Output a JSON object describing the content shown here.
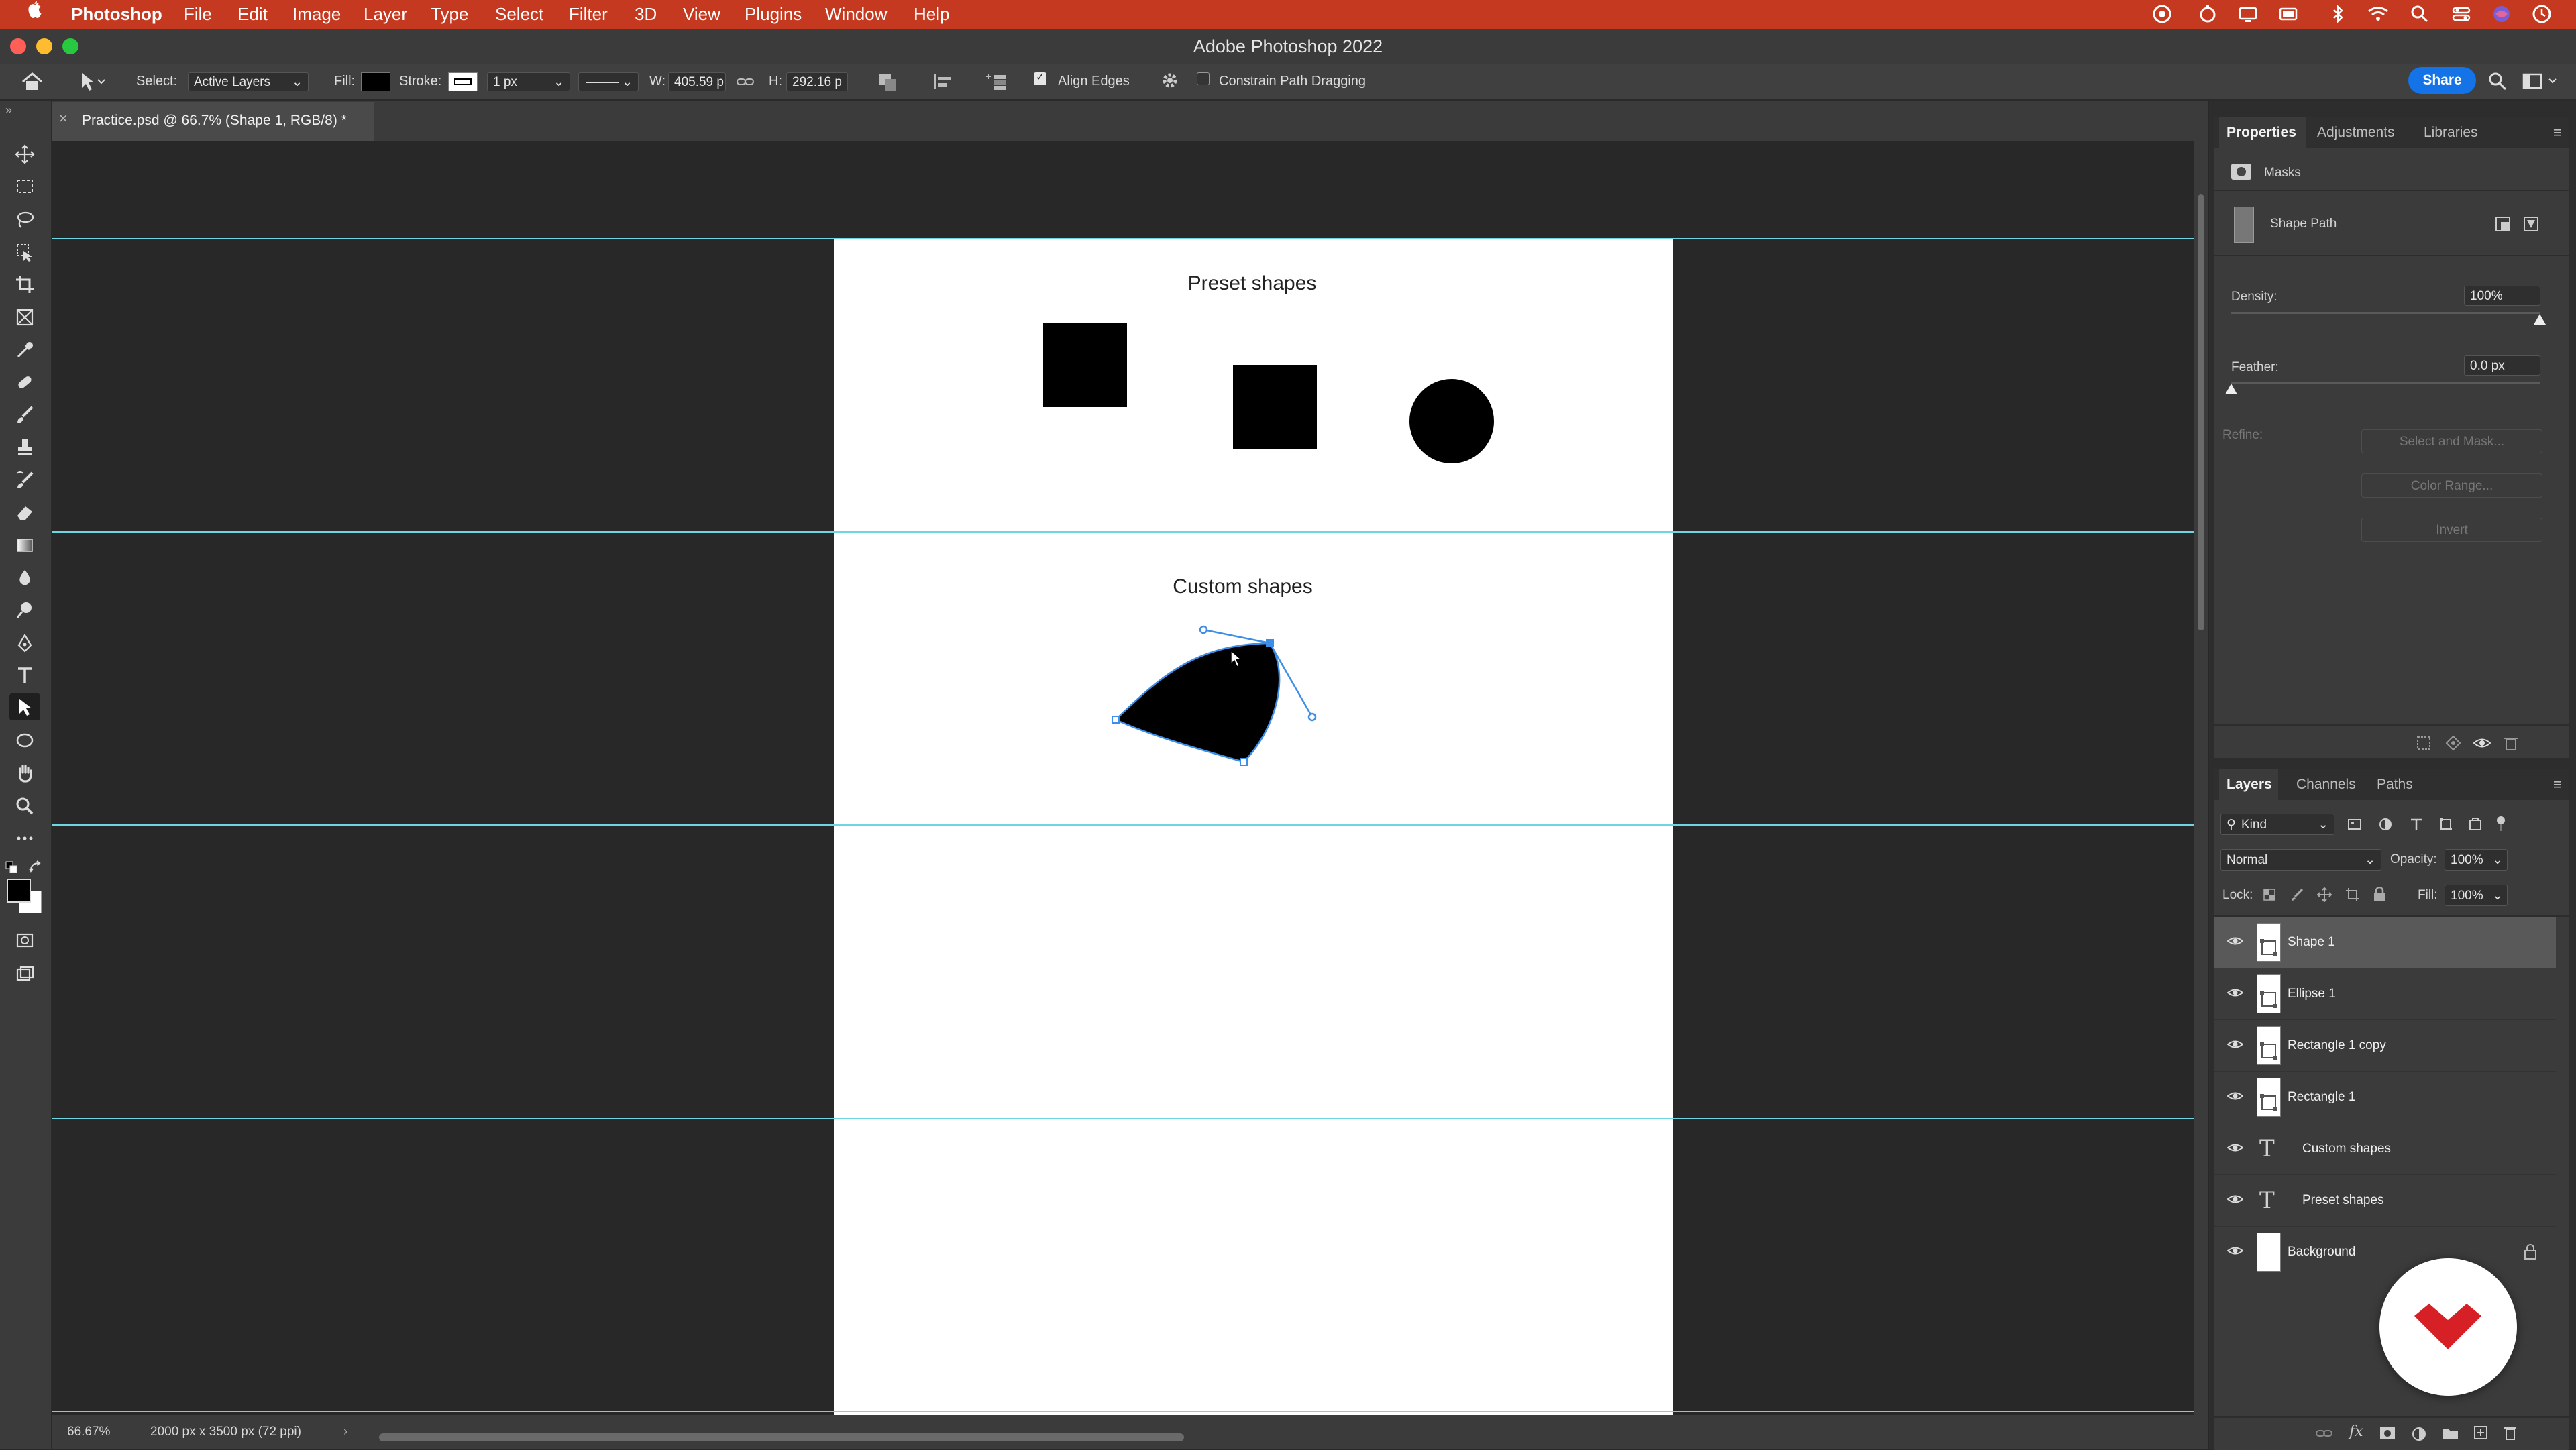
{
  "menubar": {
    "app_name": "Photoshop",
    "items": [
      "File",
      "Edit",
      "Image",
      "Layer",
      "Type",
      "Select",
      "Filter",
      "3D",
      "View",
      "Plugins",
      "Window",
      "Help"
    ],
    "tray_icons": [
      "creative-cloud-icon",
      "timer-icon",
      "display-icon",
      "screen-icon",
      "bluetooth-icon",
      "wifi-icon",
      "spotlight-search-icon",
      "control-center-icon",
      "siri-icon",
      "clock-icon"
    ]
  },
  "window": {
    "title": "Adobe Photoshop 2022"
  },
  "options_bar": {
    "select_label": "Select:",
    "select_value": "Active Layers",
    "fill_label": "Fill:",
    "stroke_label": "Stroke:",
    "stroke_width": "1 px",
    "width_label": "W:",
    "width_value": "405.59 p",
    "height_label": "H:",
    "height_value": "292.16 p",
    "align_edges_label": "Align Edges",
    "align_edges_checked": true,
    "constrain_label": "Constrain Path Dragging",
    "constrain_checked": false,
    "share_label": "Share"
  },
  "document": {
    "tab_title": "Practice.psd @ 66.7% (Shape 1, RGB/8) *",
    "preset_heading": "Preset shapes",
    "custom_heading": "Custom shapes"
  },
  "status": {
    "zoom": "66.67%",
    "doc_info": "2000 px x 3500 px (72 ppi)"
  },
  "properties": {
    "tabs": [
      "Properties",
      "Adjustments",
      "Libraries"
    ],
    "masks_label": "Masks",
    "shape_path_label": "Shape Path",
    "density_label": "Density:",
    "density_value": "100%",
    "density_level": 1.0,
    "feather_label": "Feather:",
    "feather_value": "0.0 px",
    "feather_level": 0.0,
    "refine_label": "Refine:",
    "buttons": [
      "Select and Mask...",
      "Color Range...",
      "Invert"
    ]
  },
  "layers_panel": {
    "tabs": [
      "Layers",
      "Channels",
      "Paths"
    ],
    "filter_kind": "Kind",
    "blend_mode": "Normal",
    "opacity_label": "Opacity:",
    "opacity_value": "100%",
    "lock_label": "Lock:",
    "fill_label": "Fill:",
    "fill_value": "100%",
    "layers": [
      {
        "name": "Shape 1",
        "type": "shape",
        "selected": true
      },
      {
        "name": "Ellipse 1",
        "type": "shape",
        "selected": false
      },
      {
        "name": "Rectangle 1 copy",
        "type": "shape",
        "selected": false
      },
      {
        "name": "Rectangle 1",
        "type": "shape",
        "selected": false
      },
      {
        "name": "Custom shapes",
        "type": "text",
        "selected": false
      },
      {
        "name": "Preset shapes",
        "type": "text",
        "selected": false
      },
      {
        "name": "Background",
        "type": "background",
        "selected": false,
        "locked": true
      }
    ]
  },
  "colors": {
    "menubar_bg": "#c4391f",
    "accent_blue": "#1473e6",
    "guide_cyan": "#6fd5e0",
    "path_blue": "#3d8ee6",
    "logo_red": "#d62026"
  }
}
